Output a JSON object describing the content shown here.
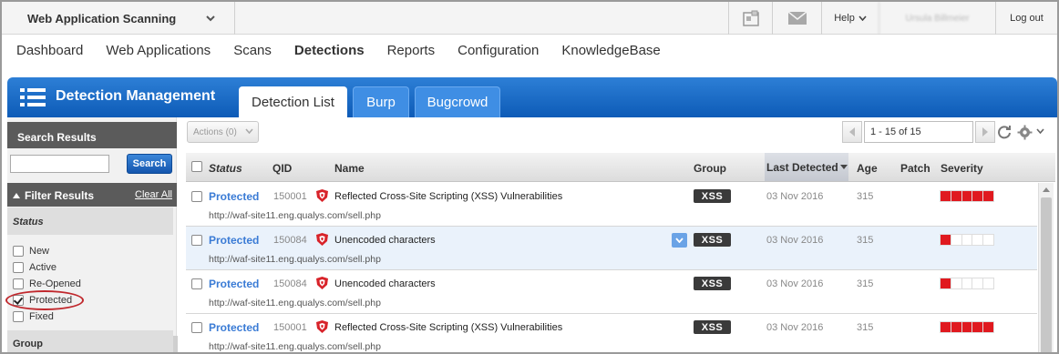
{
  "app": {
    "name": "Web Application Scanning",
    "help_label": "Help",
    "user_label": "Ursula Billmeier",
    "logout_label": "Log out"
  },
  "nav": {
    "items": [
      "Dashboard",
      "Web Applications",
      "Scans",
      "Detections",
      "Reports",
      "Configuration",
      "KnowledgeBase"
    ],
    "active": "Detections"
  },
  "header": {
    "title": "Detection Management",
    "tabs": [
      {
        "label": "Detection List",
        "active": true
      },
      {
        "label": "Burp",
        "active": false
      },
      {
        "label": "Bugcrowd",
        "active": false
      }
    ]
  },
  "sidebar": {
    "search_results_title": "Search Results",
    "search_input_value": "",
    "search_button": "Search",
    "filter_results_title": "Filter Results",
    "clear_all": "Clear All",
    "status_title": "Status",
    "status_options": [
      {
        "label": "New",
        "checked": false
      },
      {
        "label": "Active",
        "checked": false
      },
      {
        "label": "Re-Opened",
        "checked": false
      },
      {
        "label": "Protected",
        "checked": true
      },
      {
        "label": "Fixed",
        "checked": false
      }
    ],
    "group_title": "Group"
  },
  "toolbar": {
    "actions_label": "Actions (0)",
    "pager_text": "1 - 15 of 15"
  },
  "table": {
    "columns": [
      "Status",
      "QID",
      "Name",
      "Group",
      "Last Detected",
      "Age",
      "Patch",
      "Severity"
    ],
    "sorted_column": "Last Detected",
    "rows": [
      {
        "status": "Protected",
        "qid": "150001",
        "name": "Reflected Cross-Site Scripting (XSS) Vulnerabilities",
        "url": "http://waf-site11.eng.qualys.com/sell.php",
        "group": "XSS",
        "last_detected": "03 Nov 2016",
        "age": "315",
        "patch": "",
        "severity": 5
      },
      {
        "status": "Protected",
        "qid": "150084",
        "name": "Unencoded characters",
        "url": "http://waf-site11.eng.qualys.com/sell.php",
        "group": "XSS",
        "last_detected": "03 Nov 2016",
        "age": "315",
        "patch": "",
        "severity": 1
      },
      {
        "status": "Protected",
        "qid": "150084",
        "name": "Unencoded characters",
        "url": "http://waf-site11.eng.qualys.com/sell.php",
        "group": "XSS",
        "last_detected": "03 Nov 2016",
        "age": "315",
        "patch": "",
        "severity": 1
      },
      {
        "status": "Protected",
        "qid": "150001",
        "name": "Reflected Cross-Site Scripting (XSS) Vulnerabilities",
        "url": "http://waf-site11.eng.qualys.com/sell.php",
        "group": "XSS",
        "last_detected": "03 Nov 2016",
        "age": "315",
        "patch": "",
        "severity": 5
      }
    ]
  },
  "colors": {
    "accent_blue": "#0d5bb7",
    "status_link": "#3a7bd5",
    "severity_red": "#e0191f"
  }
}
